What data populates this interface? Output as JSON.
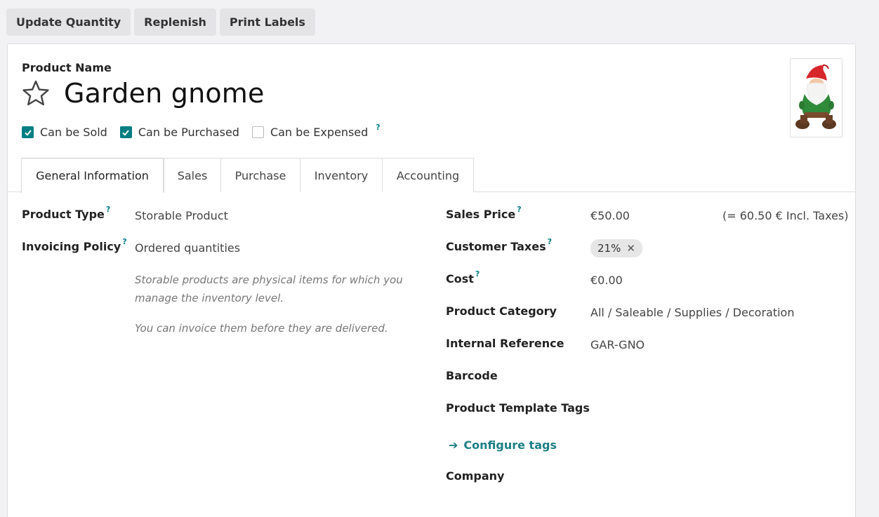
{
  "toolbar": {
    "update_quantity": "Update Quantity",
    "replenish": "Replenish",
    "print_labels": "Print Labels"
  },
  "product": {
    "name_label": "Product Name",
    "name": "Garden gnome",
    "favorite_icon": "star-outline-icon",
    "image_icon": "garden-gnome-image"
  },
  "checkboxes": [
    {
      "label": "Can be Sold",
      "checked": true
    },
    {
      "label": "Can be Purchased",
      "checked": true
    },
    {
      "label": "Can be Expensed",
      "checked": false,
      "help": "?"
    }
  ],
  "tabs": [
    "General Information",
    "Sales",
    "Purchase",
    "Inventory",
    "Accounting"
  ],
  "active_tab": "General Information",
  "left_fields": {
    "product_type": {
      "label": "Product Type",
      "help": "?",
      "value": "Storable Product"
    },
    "invoicing_policy": {
      "label": "Invoicing Policy",
      "help": "?",
      "value": "Ordered quantities"
    },
    "note_1": "Storable products are physical items for which you manage the inventory level.",
    "note_2": "You can invoice them before they are delivered."
  },
  "right_fields": {
    "sales_price": {
      "label": "Sales Price",
      "help": "?",
      "value": "€50.00",
      "incl_taxes": "(= 60.50 € Incl. Taxes)"
    },
    "customer_taxes": {
      "label": "Customer Taxes",
      "help": "?",
      "tag": "21%",
      "remove": "✕"
    },
    "cost": {
      "label": "Cost",
      "help": "?",
      "value": "€0.00"
    },
    "product_category": {
      "label": "Product Category",
      "value": "All / Saleable / Supplies / Decoration"
    },
    "internal_reference": {
      "label": "Internal Reference",
      "value": "GAR-GNO"
    },
    "barcode": {
      "label": "Barcode"
    },
    "template_tags": {
      "label": "Product Template Tags"
    },
    "configure_tags": {
      "label": "Configure tags",
      "arrow": "➔"
    },
    "company": {
      "label": "Company"
    }
  },
  "colors": {
    "accent": "#017e84",
    "link": "#1c7f84",
    "tag_bg": "#e6e6e6"
  }
}
